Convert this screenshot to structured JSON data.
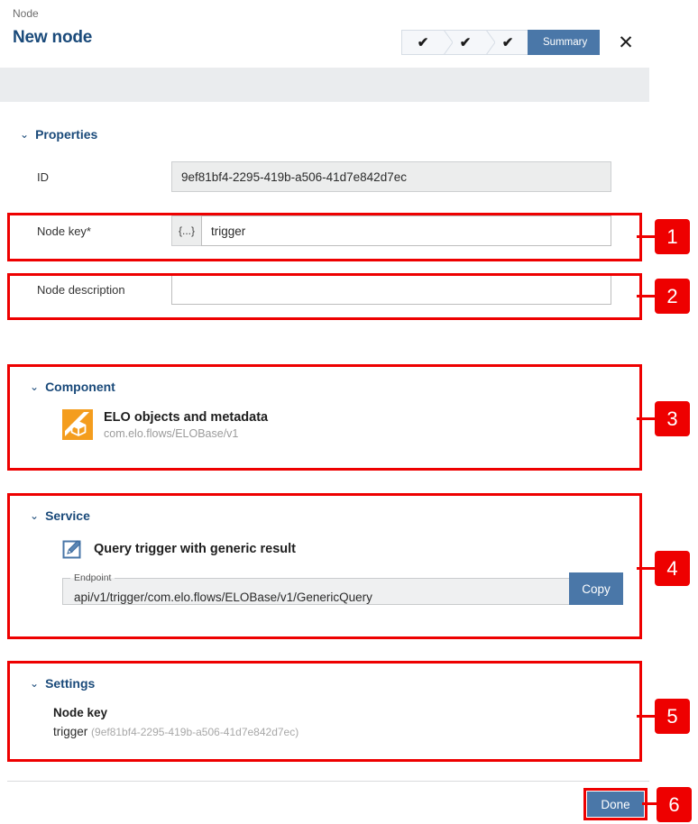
{
  "header": {
    "breadcrumb": "Node",
    "title": "New node",
    "close_label": "✕",
    "wizard": {
      "completed_glyph": "✔",
      "steps": [
        {
          "label": "✔",
          "state": "completed"
        },
        {
          "label": "✔",
          "state": "completed"
        },
        {
          "label": "✔",
          "state": "completed"
        },
        {
          "label": "Summary",
          "state": "current"
        }
      ]
    }
  },
  "sections": {
    "properties": {
      "heading": "Properties",
      "chevron": "⌄",
      "fields": {
        "id": {
          "label": "ID",
          "value": "9ef81bf4-2295-419b-a506-41d7e842d7ec"
        },
        "node_key": {
          "label": "Node key*",
          "value": "trigger",
          "expr_button": "{...}"
        },
        "node_description": {
          "label": "Node description",
          "value": "",
          "placeholder": ""
        }
      }
    },
    "component": {
      "heading": "Component",
      "chevron": "⌄",
      "name": "ELO objects and metadata",
      "identifier": "com.elo.flows/ELOBase/v1"
    },
    "service": {
      "heading": "Service",
      "chevron": "⌄",
      "name": "Query trigger with generic result",
      "endpoint_label": "Endpoint",
      "endpoint_value": "api/v1/trigger/com.elo.flows/ELOBase/v1/GenericQuery",
      "copy_label": "Copy"
    },
    "settings": {
      "heading": "Settings",
      "chevron": "⌄",
      "node_key_label": "Node key",
      "node_key_value": "trigger",
      "node_key_uuid": "(9ef81bf4-2295-419b-a506-41d7e842d7ec)"
    }
  },
  "footer": {
    "done_label": "Done"
  },
  "annotations": {
    "badges": [
      {
        "number": "1"
      },
      {
        "number": "2"
      },
      {
        "number": "3"
      },
      {
        "number": "4"
      },
      {
        "number": "5"
      },
      {
        "number": "6"
      }
    ]
  },
  "colors": {
    "accent_blue": "#4a77a8",
    "title_blue": "#1a4a7a",
    "annotation_red": "#ee0000",
    "component_orange": "#f49d1e",
    "grey_band": "#eaecee"
  }
}
